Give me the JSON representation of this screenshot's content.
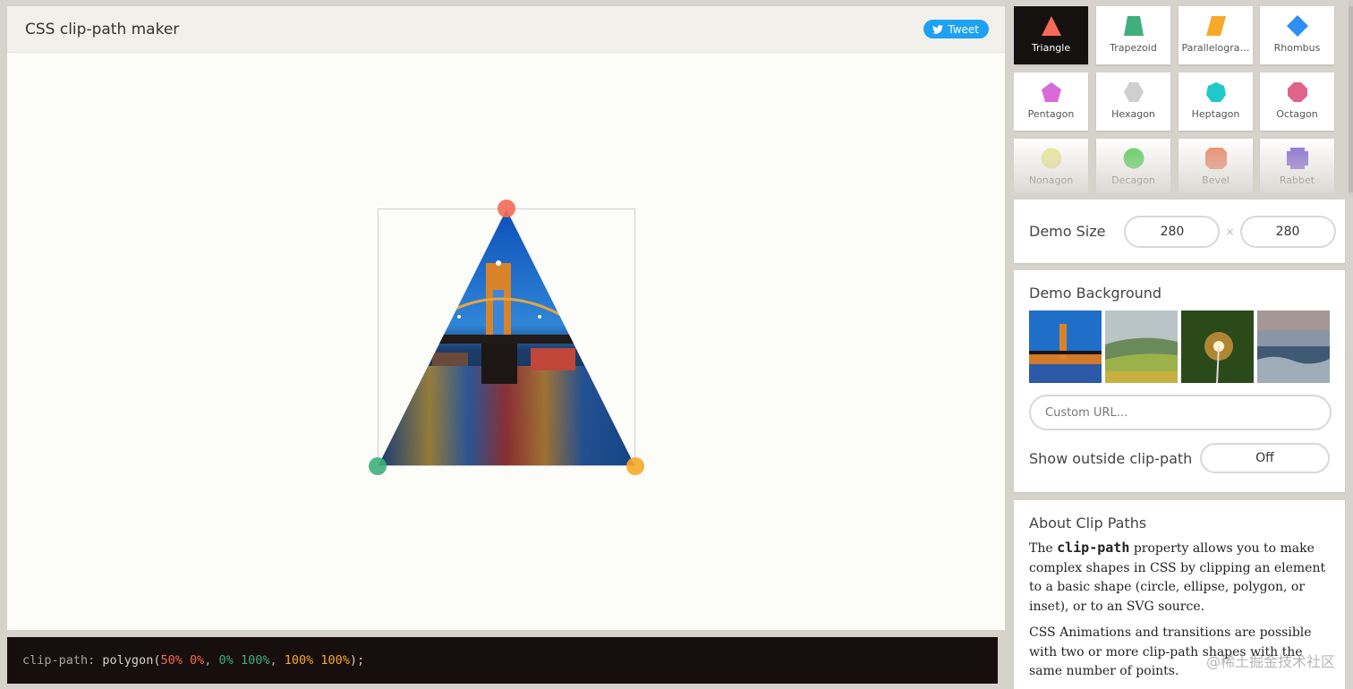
{
  "header": {
    "title": "CSS clip-path maker",
    "tweet_label": "Tweet",
    "tweet_icon": "twitter-bird-icon"
  },
  "editor": {
    "shape": "Triangle",
    "handle_colors": [
      "#f46a55",
      "#3fb07d",
      "#f7a928"
    ]
  },
  "code": {
    "property": "clip-path:",
    "function": "polygon(",
    "p1x": "50%",
    "p1y": "0%",
    "sep1": ",",
    "p2x": "0%",
    "p2y": "100%",
    "sep2": ",",
    "p3x": "100%",
    "p3y": "100%",
    "end": ");",
    "colors": {
      "p1": "#f46a55",
      "p2": "#3fb07d",
      "p3": "#f7a928"
    }
  },
  "shapes": [
    {
      "label": "Triangle",
      "color": "#f46a55",
      "active": true
    },
    {
      "label": "Trapezoid",
      "color": "#3fb07d"
    },
    {
      "label": "Parallelogra…",
      "color": "#f7a928"
    },
    {
      "label": "Rhombus",
      "color": "#2e8ff0"
    },
    {
      "label": "Pentagon",
      "color": "#d96ad8"
    },
    {
      "label": "Hexagon",
      "color": "#cfcfcf"
    },
    {
      "label": "Heptagon",
      "color": "#1fc8c9"
    },
    {
      "label": "Octagon",
      "color": "#e0638a"
    },
    {
      "label": "Nonagon",
      "color": "#ecec9a"
    },
    {
      "label": "Decagon",
      "color": "#5cd15c"
    },
    {
      "label": "Bevel",
      "color": "#ef8a6a"
    },
    {
      "label": "Rabbet",
      "color": "#8a6fd6"
    }
  ],
  "size": {
    "label": "Demo Size",
    "width": "280",
    "height": "280",
    "times": "×"
  },
  "background": {
    "label": "Demo Background",
    "thumbnails": [
      "bridge-night",
      "green-hills",
      "sparkler",
      "ocean-waves"
    ],
    "custom_url_placeholder": "Custom URL...",
    "outside_label": "Show outside clip-path",
    "outside_value": "Off"
  },
  "about": {
    "title": "About Clip Paths",
    "p1_before": "The ",
    "p1_code": "clip-path",
    "p1_after": " property allows you to make complex shapes in CSS by clipping an element to a basic shape (circle, ellipse, polygon, or inset), or to an SVG source.",
    "p2": "CSS Animations and transitions are possible with two or more clip-path shapes with the same number of points."
  },
  "watermark": "@稀土掘金技术社区"
}
